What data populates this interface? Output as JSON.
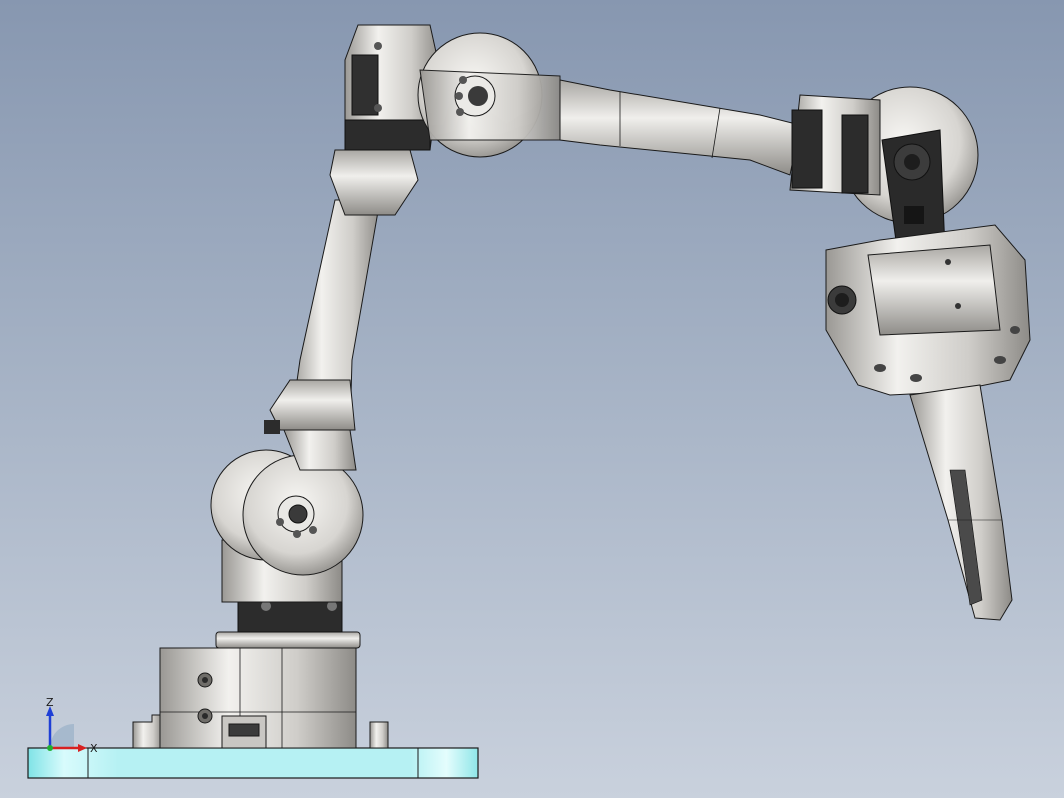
{
  "viewport": {
    "background_top": "#8797b0",
    "background_bottom": "#c9d1dd",
    "metal_color": "#d8d6d2",
    "dark_part_color": "#2c2c2c",
    "base_plate_color": "#b8f2f4",
    "edge_color": "#1a1a1a"
  },
  "triad": {
    "z_label": "Z",
    "x_label": "X",
    "z_color": "#1e3fd6",
    "x_color": "#d82020",
    "y_color": "#20b030"
  }
}
